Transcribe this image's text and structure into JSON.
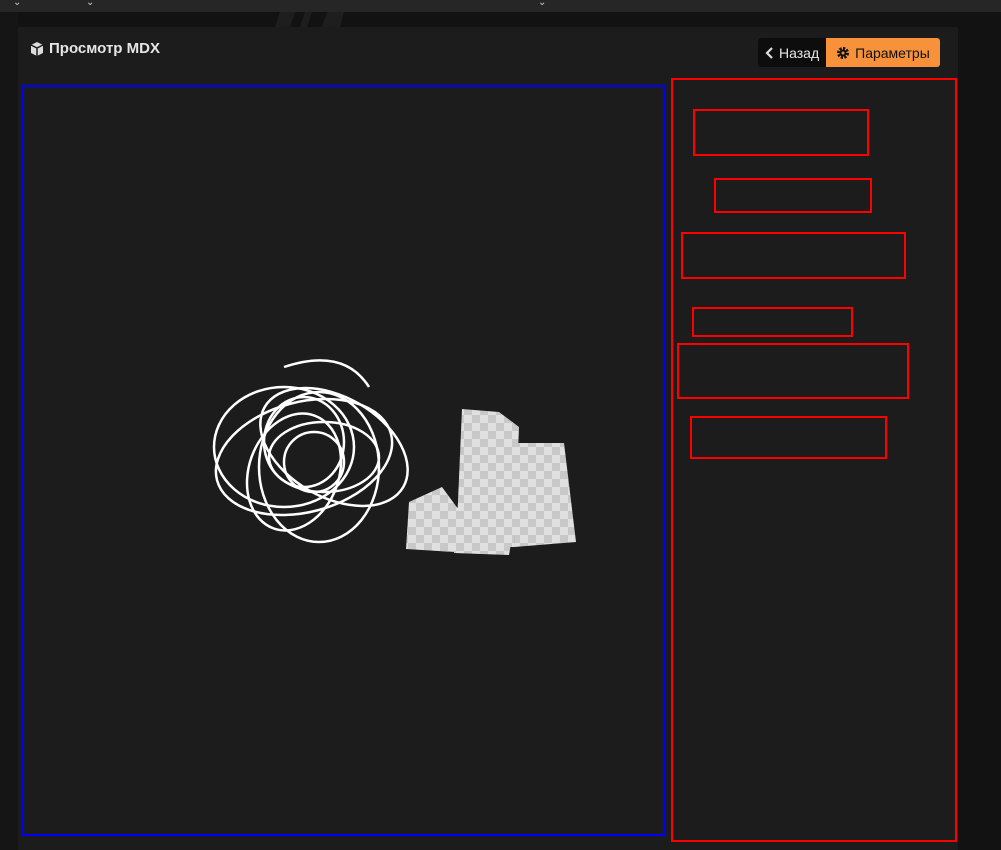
{
  "header": {
    "title": "Просмотр MDX",
    "icon": "cube-icon"
  },
  "toolbar": {
    "back_label": "Назад",
    "params_label": "Параметры",
    "back_icon": "chevron-left-icon",
    "params_icon": "gear-icon"
  },
  "colors": {
    "accent": "#f7913a",
    "viewer_border": "#0000ff",
    "sidebar_border": "#ff0000"
  }
}
